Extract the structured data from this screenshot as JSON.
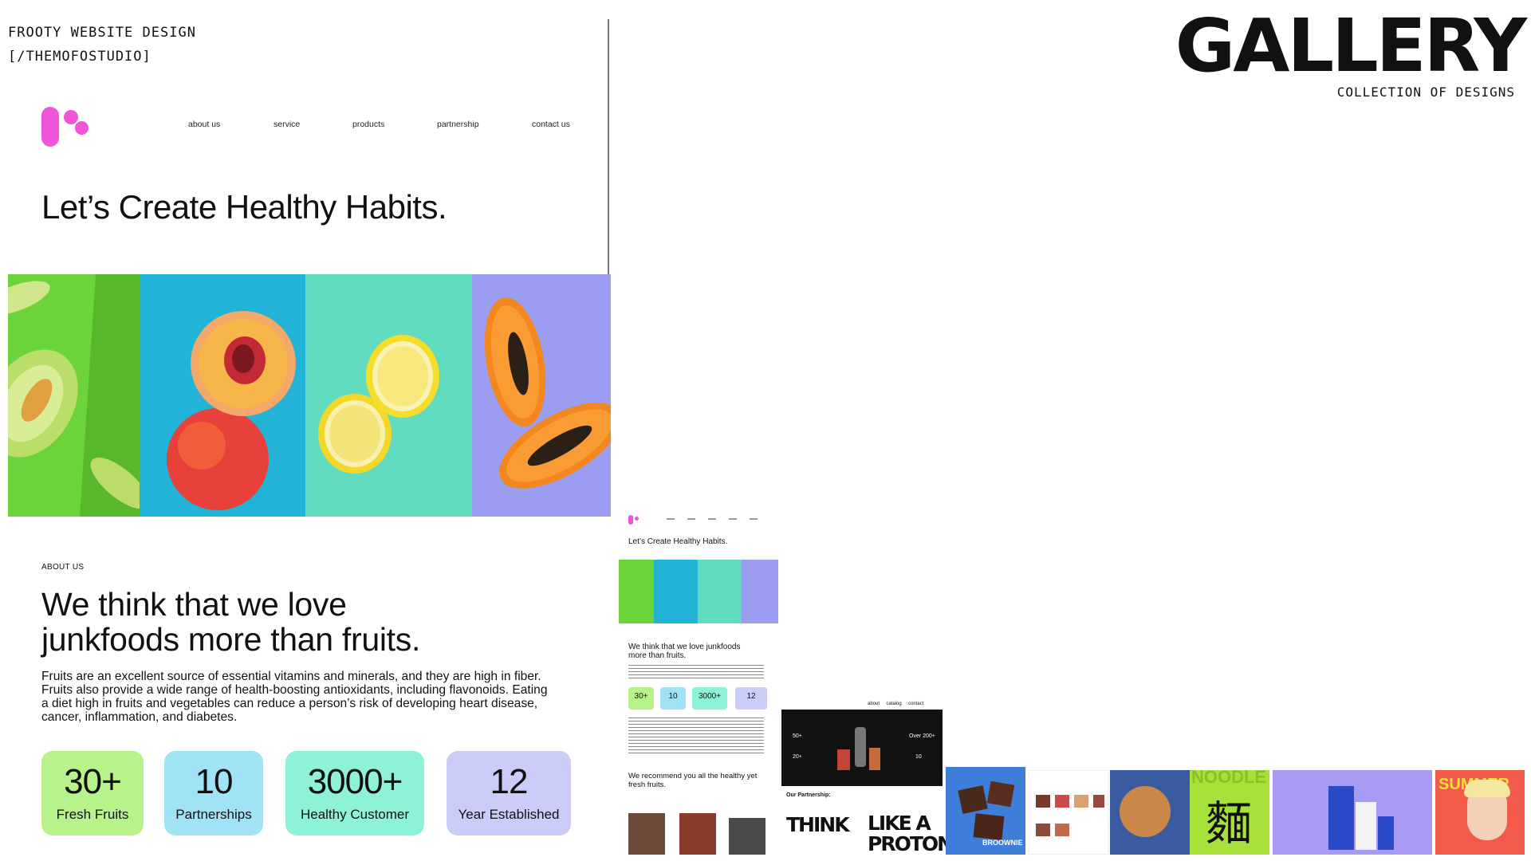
{
  "header": {
    "project_line1": "FROOTY WEBSITE DESIGN",
    "project_line2": "[/THEMOFOSTUDIO]",
    "gallery_title": "GALLERY",
    "gallery_subtitle": "COLLECTION OF DESIGNS"
  },
  "site": {
    "brand_color": "#ee55d9",
    "nav": [
      "about us",
      "service",
      "products",
      "partnership",
      "contact us"
    ],
    "headline": "Let’s Create Healthy Habits.",
    "fruit_panels": [
      {
        "name": "melon",
        "bg": "#6bd43a"
      },
      {
        "name": "peach",
        "bg": "#22b3d6"
      },
      {
        "name": "lemon",
        "bg": "#61dcc0"
      },
      {
        "name": "papaya",
        "bg": "#9b9ef0"
      }
    ],
    "about": {
      "label": "ABOUT US",
      "heading": "We think that we love junkfoods more than fruits.",
      "paragraph": "Fruits are an excellent source of essential vitamins and minerals, and they are high in fiber. Fruits also provide a wide range of health-boosting antioxidants, including flavonoids. Eating a diet high in fruits and vegetables can reduce a person’s risk of developing heart disease, cancer, inflammation, and diabetes."
    },
    "stats": [
      {
        "value": "30+",
        "label": "Fresh Fruits",
        "color": "#b8f28a"
      },
      {
        "value": "10",
        "label": "Partnerships",
        "color": "#9fe3f5"
      },
      {
        "value": "3000+",
        "label": "Healthy Customer",
        "color": "#8df2d7"
      },
      {
        "value": "12",
        "label": "Year Established",
        "color": "#cbccf8"
      }
    ]
  },
  "thumbnails": {
    "mini_headline": "Let’s Create Healthy Habits.",
    "mini_heading": "We think that we love junkfoods more than fruits.",
    "mini_recommend": "We recommend you all the healthy yet fresh fruits.",
    "mini_stats": [
      "30+",
      "10",
      "3000+",
      "12"
    ],
    "lab": {
      "nav": [
        "about",
        "catalog",
        "contact"
      ],
      "stat1": "50+",
      "stat2": "20+",
      "stat3": "Over 200+",
      "stat4": "10",
      "partnership_label": "Our Partnership:",
      "think1": "THINK",
      "think2": "LIKE A",
      "think3": "PROTON"
    },
    "brownie_label": "BROOWNIE",
    "noodle_text": "NOODLE",
    "noodle_glyph": "麵",
    "summer_text": "SUMMER"
  }
}
